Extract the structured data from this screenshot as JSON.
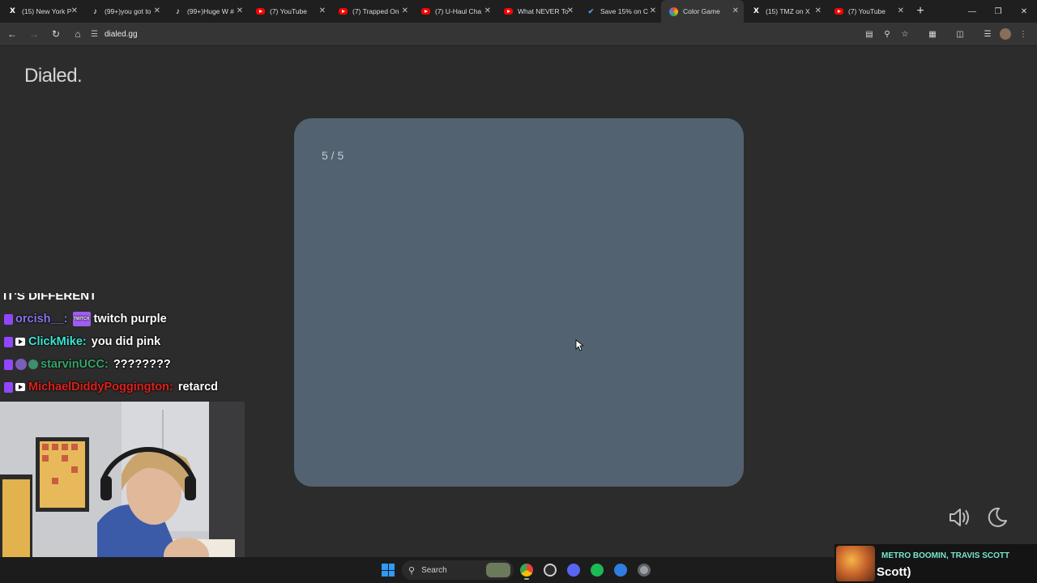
{
  "browser": {
    "tabs": [
      {
        "favicon": "x-logo-icon",
        "title": "(15) New York P",
        "active": false
      },
      {
        "favicon": "tiktok-icon",
        "title": "(99+)you got to",
        "active": false
      },
      {
        "favicon": "tiktok-icon",
        "title": "(99+)Huge W #",
        "active": false
      },
      {
        "favicon": "youtube-icon",
        "title": "(7) YouTube",
        "active": false
      },
      {
        "favicon": "youtube-icon",
        "title": "(7) Trapped On",
        "active": false
      },
      {
        "favicon": "youtube-icon",
        "title": "(7) U-Haul Cha",
        "active": false
      },
      {
        "favicon": "youtube-icon",
        "title": "What NEVER To",
        "active": false
      },
      {
        "favicon": "checkmark-icon",
        "title": "Save 15% on C",
        "active": false
      },
      {
        "favicon": "color-wheel-icon",
        "title": "Color Game",
        "active": true
      },
      {
        "favicon": "x-logo-icon",
        "title": "(15) TMZ on X",
        "active": false
      },
      {
        "favicon": "youtube-icon",
        "title": "(7) YouTube",
        "active": false
      }
    ],
    "new_tab_glyph": "+",
    "url": "dialed.gg"
  },
  "page": {
    "logo": "Dialed.",
    "counter": "5 / 5",
    "card_color": "#526270"
  },
  "chat": {
    "partial_line": "IT'S DIFFERENT",
    "messages": [
      {
        "user": "orcish__",
        "text": "twitch purple",
        "color": "#8c74f0",
        "emote": "TWITCH"
      },
      {
        "user": "ClickMike",
        "text": "you did pink",
        "color": "#38e8d6"
      },
      {
        "user": "starvinUCC",
        "text": "????????",
        "color": "#36a56c"
      },
      {
        "user": "MichaelDiddyPoggington",
        "text": "retarcd",
        "color": "#e0201c"
      }
    ]
  },
  "taskbar": {
    "search_label": "Search"
  },
  "now_playing": {
    "artist": "METRO BOOMIN, TRAVIS SCOTT",
    "title": "Scott)"
  },
  "colors": {
    "background": "#2c2c2c",
    "card": "#526270",
    "tab_strip": "#1f1f1f",
    "active_tab": "#353535"
  }
}
